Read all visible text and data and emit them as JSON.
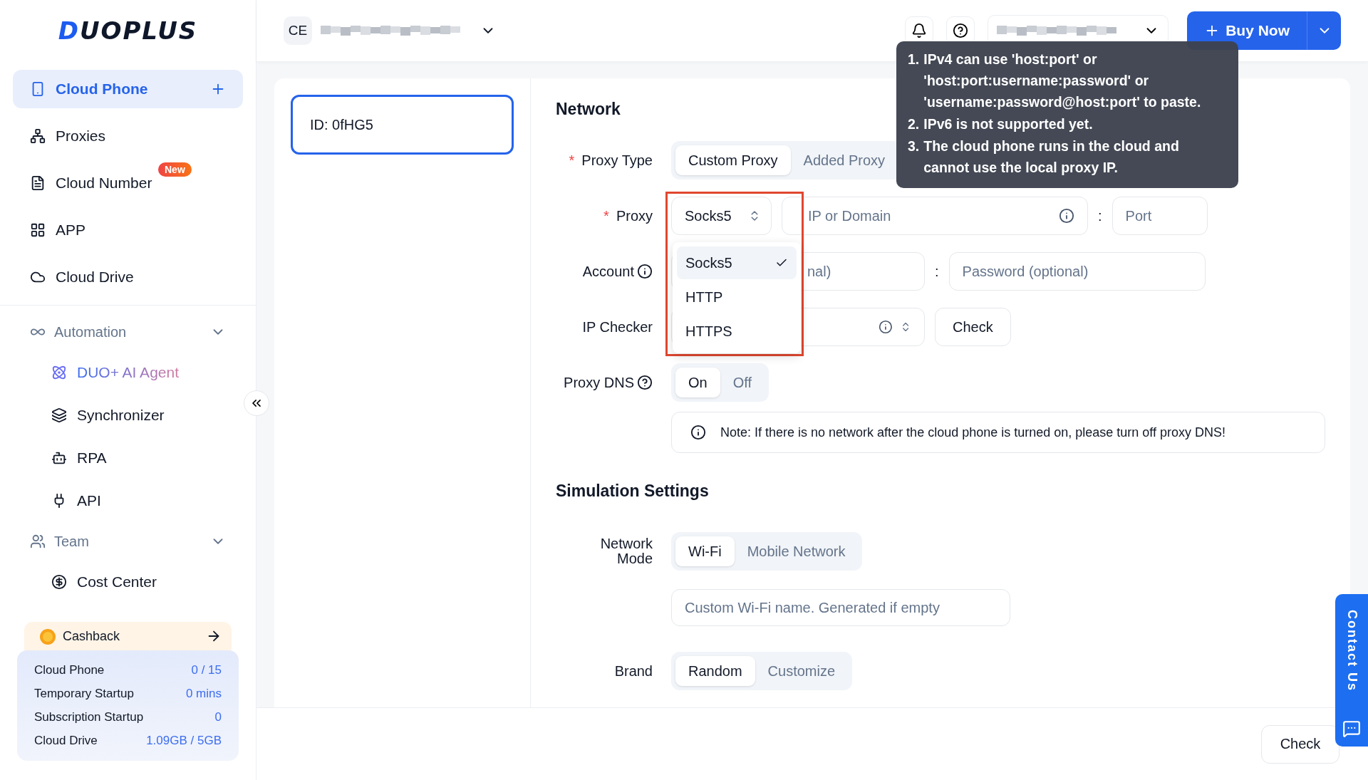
{
  "sidebar": {
    "logo": "DUOPLUS",
    "nav": [
      {
        "label": "Cloud Phone",
        "selected": true,
        "add_button": true
      },
      {
        "label": "Proxies",
        "selected": false,
        "add_button": false
      },
      {
        "label": "Cloud Number",
        "selected": false,
        "add_button": false,
        "badge": "New"
      },
      {
        "label": "APP",
        "selected": false,
        "add_button": false
      },
      {
        "label": "Cloud Drive",
        "selected": false,
        "add_button": false
      }
    ],
    "groups": [
      {
        "label": "Automation",
        "expanded": true,
        "children": [
          {
            "label": "DUO+ AI Agent",
            "kind": "featured"
          },
          {
            "label": "Synchronizer",
            "kind": "plain"
          },
          {
            "label": "RPA",
            "kind": "plain"
          },
          {
            "label": "API",
            "kind": "plain"
          }
        ]
      },
      {
        "label": "Team",
        "expanded": true,
        "children": [
          {
            "label": "Cost Center",
            "kind": "plain"
          }
        ]
      }
    ],
    "cashback": {
      "label": "Cashback"
    },
    "stats": [
      {
        "label": "Cloud Phone",
        "value": "0 / 15"
      },
      {
        "label": "Temporary Startup",
        "value": "0 mins"
      },
      {
        "label": "Subscription Startup",
        "value": "0"
      },
      {
        "label": "Cloud Drive",
        "value": "1.09GB / 5GB"
      }
    ]
  },
  "header": {
    "avatar": "CE",
    "buy_button": "Buy Now"
  },
  "device": {
    "id": "ID: 0fHG5",
    "selected": true
  },
  "network": {
    "title": "Network",
    "proxy_type": {
      "label": "Proxy Type",
      "required_mark": "*",
      "options": [
        {
          "label": "Custom Proxy",
          "selected": true
        },
        {
          "label": "Added Proxy",
          "selected": false
        }
      ]
    },
    "proxy": {
      "label": "Proxy",
      "required_mark": "*",
      "protocol": "Socks5",
      "host_placeholder": "IP or Domain",
      "separator": ":",
      "port_placeholder": "Port"
    },
    "account": {
      "label": "Account",
      "username_placeholder_visible": "nal)",
      "separator": ":",
      "password_placeholder": "Password (optional)"
    },
    "ip_checker": {
      "label": "IP Checker",
      "button": "Check"
    },
    "proxy_dns": {
      "label": "Proxy DNS",
      "options": [
        {
          "label": "On",
          "selected": true
        },
        {
          "label": "Off",
          "selected": false
        }
      ]
    },
    "note": "Note: If there is no network after the cloud phone is turned on, please turn off proxy DNS!"
  },
  "protocol_menu": {
    "options": [
      {
        "label": "Socks5",
        "selected": true
      },
      {
        "label": "HTTP",
        "selected": false
      },
      {
        "label": "HTTPS",
        "selected": false
      }
    ]
  },
  "simulation": {
    "title": "Simulation Settings",
    "network_mode": {
      "label": "Network Mode",
      "options": [
        {
          "label": "Wi-Fi",
          "selected": true
        },
        {
          "label": "Mobile Network",
          "selected": false
        }
      ]
    },
    "wifi_placeholder": "Custom Wi-Fi name. Generated if empty",
    "brand": {
      "label": "Brand",
      "options": [
        {
          "label": "Random",
          "selected": true
        },
        {
          "label": "Customize",
          "selected": false
        }
      ]
    }
  },
  "tooltip": {
    "items": [
      {
        "number": "1.",
        "text": "IPv4 can use 'host:port' or 'host:port:username:password' or 'username:password@host:port' to paste."
      },
      {
        "number": "2.",
        "text": "IPv6 is not supported yet."
      },
      {
        "number": "3.",
        "text": "The cloud phone runs in the cloud and cannot use the local proxy IP."
      }
    ]
  },
  "footer": {
    "button": "Check"
  },
  "contact": {
    "label": "Contact Us"
  }
}
